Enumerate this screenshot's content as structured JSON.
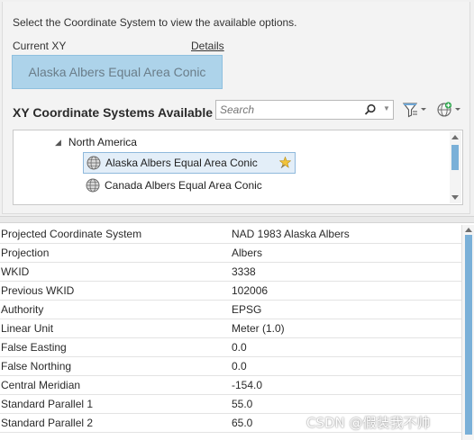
{
  "instruction": "Select the Coordinate System to view the available options.",
  "current": {
    "label": "Current XY",
    "details_link": "Details",
    "value": "Alaska Albers Equal Area Conic"
  },
  "available": {
    "title": "XY Coordinate Systems Available",
    "search_placeholder": "Search",
    "tree": {
      "group": "North America",
      "items": [
        {
          "label": "Alaska Albers Equal Area Conic",
          "selected": true,
          "favorite_icon": "pin-star-icon"
        },
        {
          "label": "Canada Albers Equal Area Conic",
          "selected": false
        }
      ]
    }
  },
  "properties": [
    {
      "key": "Projected Coordinate System",
      "value": "NAD 1983 Alaska Albers"
    },
    {
      "key": "Projection",
      "value": "Albers"
    },
    {
      "key": "WKID",
      "value": "3338"
    },
    {
      "key": "Previous WKID",
      "value": "102006"
    },
    {
      "key": "Authority",
      "value": "EPSG"
    },
    {
      "key": "Linear Unit",
      "value": "Meter (1.0)"
    },
    {
      "key": "False Easting",
      "value": "0.0"
    },
    {
      "key": "False Northing",
      "value": "0.0"
    },
    {
      "key": "Central Meridian",
      "value": "-154.0"
    },
    {
      "key": "Standard Parallel 1",
      "value": "55.0"
    },
    {
      "key": "Standard Parallel 2",
      "value": "65.0"
    }
  ],
  "watermark": "CSDN @假装我不帅",
  "colors": {
    "current_box": "#add3ea",
    "selection": "#e3eef8",
    "scroll_thumb": "#7ab0d8"
  }
}
